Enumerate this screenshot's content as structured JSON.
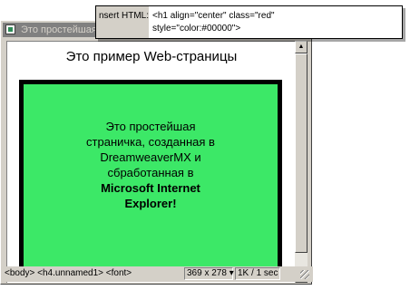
{
  "window": {
    "title": "Это простейшая"
  },
  "page": {
    "heading": "Это пример Web-страницы",
    "box_lines": [
      "Это простейшая",
      "страничка, созданная в",
      "DreamweaverMX и",
      "сбработанная в"
    ],
    "box_bold_lines": [
      "Microsoft Internet",
      "Explorer!"
    ]
  },
  "statusbar": {
    "tag_path": "<body> <h4.unnamed1> <font>",
    "window_size": "369 x 278 ▾",
    "download": "1K / 1 sec"
  },
  "popup": {
    "label": "nsert HTML:",
    "code": "<h1 align=\"center\" class=\"red\"\nstyle=\"color:#00000\">"
  },
  "scrollbar": {
    "up_icon": "▲",
    "down_icon": "▼"
  },
  "colors": {
    "box_fill": "#3ce867",
    "box_border": "#000000",
    "chrome": "#d4d0c8"
  }
}
